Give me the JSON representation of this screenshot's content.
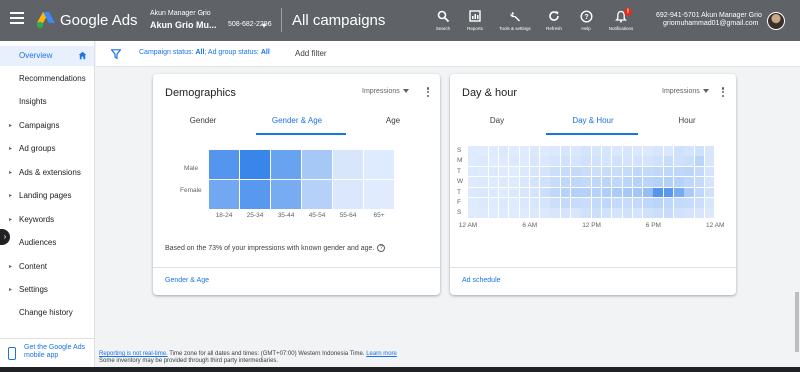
{
  "topbar": {
    "brand": "Google Ads",
    "account_name": "Akun Manager Grio",
    "account_sub": "Akun Grio Mu...",
    "account_id": "508-682-2296",
    "page_title": "All campaigns",
    "tools": [
      {
        "label": "Search",
        "icon": "search-icon"
      },
      {
        "label": "Reports",
        "icon": "reports-icon"
      },
      {
        "label": "Tools & settings",
        "icon": "wrench-icon"
      },
      {
        "label": "Refresh",
        "icon": "refresh-icon"
      },
      {
        "label": "Help",
        "icon": "help-icon"
      },
      {
        "label": "Notifications",
        "icon": "bell-icon"
      }
    ],
    "notification_badge": "!",
    "user_line1": "692-941-5701 Akun Manager Grio",
    "user_line2": "griomuhammad01@gmail.com"
  },
  "sidebar": {
    "items": [
      {
        "label": "Overview",
        "active": true,
        "arrow": false
      },
      {
        "label": "Recommendations",
        "arrow": false
      },
      {
        "label": "Insights",
        "arrow": false
      },
      {
        "label": "Campaigns",
        "arrow": true
      },
      {
        "label": "Ad groups",
        "arrow": true
      },
      {
        "label": "Ads & extensions",
        "arrow": true
      },
      {
        "label": "Landing pages",
        "arrow": true
      },
      {
        "label": "Keywords",
        "arrow": true
      },
      {
        "label": "Audiences",
        "arrow": false
      },
      {
        "label": "Content",
        "arrow": true
      },
      {
        "label": "Settings",
        "arrow": true
      },
      {
        "label": "Change history",
        "arrow": false
      }
    ],
    "mobile_app": "Get the Google Ads mobile app"
  },
  "filterbar": {
    "campaign_status_label": "Campaign status:",
    "campaign_status_value": "All",
    "adgroup_status_label": "Ad group status:",
    "adgroup_status_value": "All",
    "add_filter": "Add filter"
  },
  "demographics": {
    "title": "Demographics",
    "metric": "Impressions",
    "tabs": [
      "Gender",
      "Gender & Age",
      "Age"
    ],
    "selected_tab": 1,
    "rows": [
      "Male",
      "Female"
    ],
    "columns": [
      "18-24",
      "25-34",
      "35-44",
      "45-54",
      "55-64",
      "65+"
    ],
    "intensity": [
      [
        0.72,
        0.85,
        0.62,
        0.32,
        0.08,
        0.05
      ],
      [
        0.58,
        0.7,
        0.55,
        0.25,
        0.07,
        0.04
      ]
    ],
    "note": "Based on the 73% of your impressions with known gender and age.",
    "footer_link": "Gender & Age"
  },
  "dayhour": {
    "title": "Day & hour",
    "metric": "Impressions",
    "tabs": [
      "Day",
      "Day & Hour",
      "Hour"
    ],
    "selected_tab": 1,
    "days": [
      "S",
      "M",
      "T",
      "W",
      "T",
      "F",
      "S"
    ],
    "hour_labels": [
      "12 AM",
      "6 AM",
      "12 PM",
      "6 PM",
      "12 AM"
    ],
    "intensity": [
      [
        0.05,
        0.04,
        0.05,
        0.06,
        0.04,
        0.05,
        0.06,
        0.05,
        0.06,
        0.08,
        0.07,
        0.1,
        0.08,
        0.09,
        0.07,
        0.08,
        0.07,
        0.06,
        0.08,
        0.07,
        0.12,
        0.1,
        0.12,
        0.08
      ],
      [
        0.05,
        0.06,
        0.04,
        0.05,
        0.06,
        0.05,
        0.08,
        0.07,
        0.1,
        0.12,
        0.1,
        0.12,
        0.11,
        0.1,
        0.12,
        0.1,
        0.11,
        0.1,
        0.12,
        0.15,
        0.12,
        0.14,
        0.22,
        0.08
      ],
      [
        0.06,
        0.05,
        0.06,
        0.05,
        0.04,
        0.06,
        0.08,
        0.1,
        0.14,
        0.16,
        0.18,
        0.15,
        0.14,
        0.16,
        0.15,
        0.17,
        0.2,
        0.18,
        0.19,
        0.2,
        0.2,
        0.22,
        0.18,
        0.1
      ],
      [
        0.05,
        0.06,
        0.05,
        0.06,
        0.05,
        0.07,
        0.1,
        0.12,
        0.16,
        0.2,
        0.2,
        0.18,
        0.2,
        0.22,
        0.2,
        0.22,
        0.24,
        0.22,
        0.25,
        0.26,
        0.24,
        0.2,
        0.18,
        0.1
      ],
      [
        0.06,
        0.07,
        0.06,
        0.05,
        0.06,
        0.08,
        0.1,
        0.14,
        0.2,
        0.24,
        0.26,
        0.25,
        0.24,
        0.28,
        0.3,
        0.32,
        0.34,
        0.4,
        0.72,
        0.7,
        0.55,
        0.3,
        0.2,
        0.12
      ],
      [
        0.05,
        0.06,
        0.05,
        0.06,
        0.05,
        0.07,
        0.08,
        0.1,
        0.14,
        0.18,
        0.16,
        0.15,
        0.18,
        0.2,
        0.18,
        0.16,
        0.18,
        0.2,
        0.22,
        0.2,
        0.18,
        0.16,
        0.14,
        0.08
      ],
      [
        0.04,
        0.05,
        0.04,
        0.05,
        0.04,
        0.05,
        0.06,
        0.06,
        0.08,
        0.1,
        0.08,
        0.12,
        0.14,
        0.12,
        0.1,
        0.12,
        0.1,
        0.12,
        0.14,
        0.16,
        0.12,
        0.1,
        0.08,
        0.06
      ]
    ],
    "footer_link": "Ad schedule"
  },
  "footer": {
    "link1": "Reporting is not real-time.",
    "text1": " Time zone for all dates and times: (GMT+07:00) Western Indonesia Time. ",
    "link2": "Learn more",
    "text2": "Some inventory may be provided through third party intermediaries."
  },
  "colors": {
    "heat": "#1a73e8",
    "accent": "#1a73e8",
    "topbar": "#5f6368"
  }
}
